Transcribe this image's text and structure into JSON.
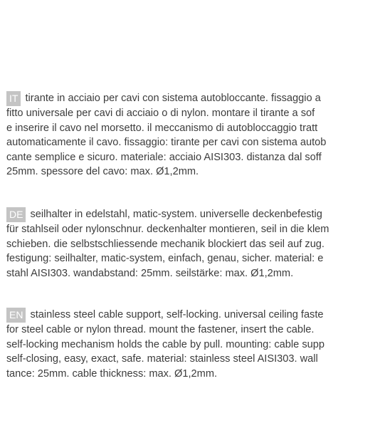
{
  "sections": [
    {
      "lang": "IT",
      "lines": [
        "tirante in acciaio per cavi con sistema autobloccante. fissaggio a",
        "fitto universale per cavi di acciaio o di nylon. montare il tirante a sof",
        "e inserire il cavo nel morsetto. il meccanismo di autobloccaggio tratt",
        "automaticamente il cavo. fissaggio: tirante per cavi con sistema autob",
        "cante semplice e sicuro. materiale: acciaio AISI303. distanza dal soff",
        "25mm. spessore del cavo: max. Ø1,2mm."
      ]
    },
    {
      "lang": "DE",
      "lines": [
        "seilhalter in edelstahl, matic-system. universelle deckenbefestig",
        "für stahlseil oder nylonschnur. deckenhalter montieren, seil in die klem",
        "schieben. die selbstschliessende mechanik blockiert das seil auf zug.",
        "festigung: seilhalter, matic-system, einfach, genau, sicher. material: e",
        "stahl AISI303. wandabstand: 25mm. seilstärke: max. Ø1,2mm."
      ]
    },
    {
      "lang": "EN",
      "lines": [
        "stainless steel cable support, self-locking. universal ceiling faste",
        "for steel cable or nylon thread. mount the  fastener, insert the cable.",
        "self-locking mechanism holds the cable by pull. mounting: cable supp",
        "self-closing, easy, exact, safe. material: stainless steel AISI303. wall",
        "tance: 25mm. cable thickness: max. Ø1,2mm."
      ]
    }
  ]
}
